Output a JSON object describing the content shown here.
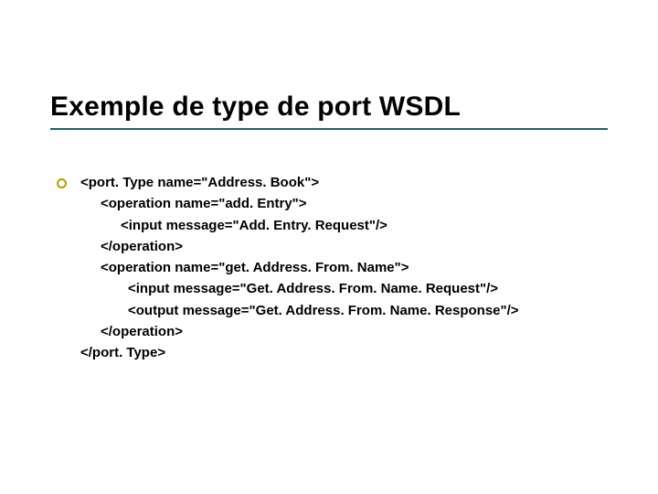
{
  "title": "Exemple de type de port WSDL",
  "code": {
    "l0": "<port. Type name=\"Address. Book\">",
    "l1": "<operation name=\"add. Entry\">",
    "l2": "<input message=\"Add. Entry. Request\"/>",
    "l3": "</operation>",
    "l4": "<operation name=\"get. Address. From. Name\">",
    "l5": "<input message=\"Get. Address. From. Name. Request\"/>",
    "l6": "<output message=\"Get. Address. From. Name. Response\"/>",
    "l7": "</operation>",
    "l8": "</port. Type>"
  }
}
